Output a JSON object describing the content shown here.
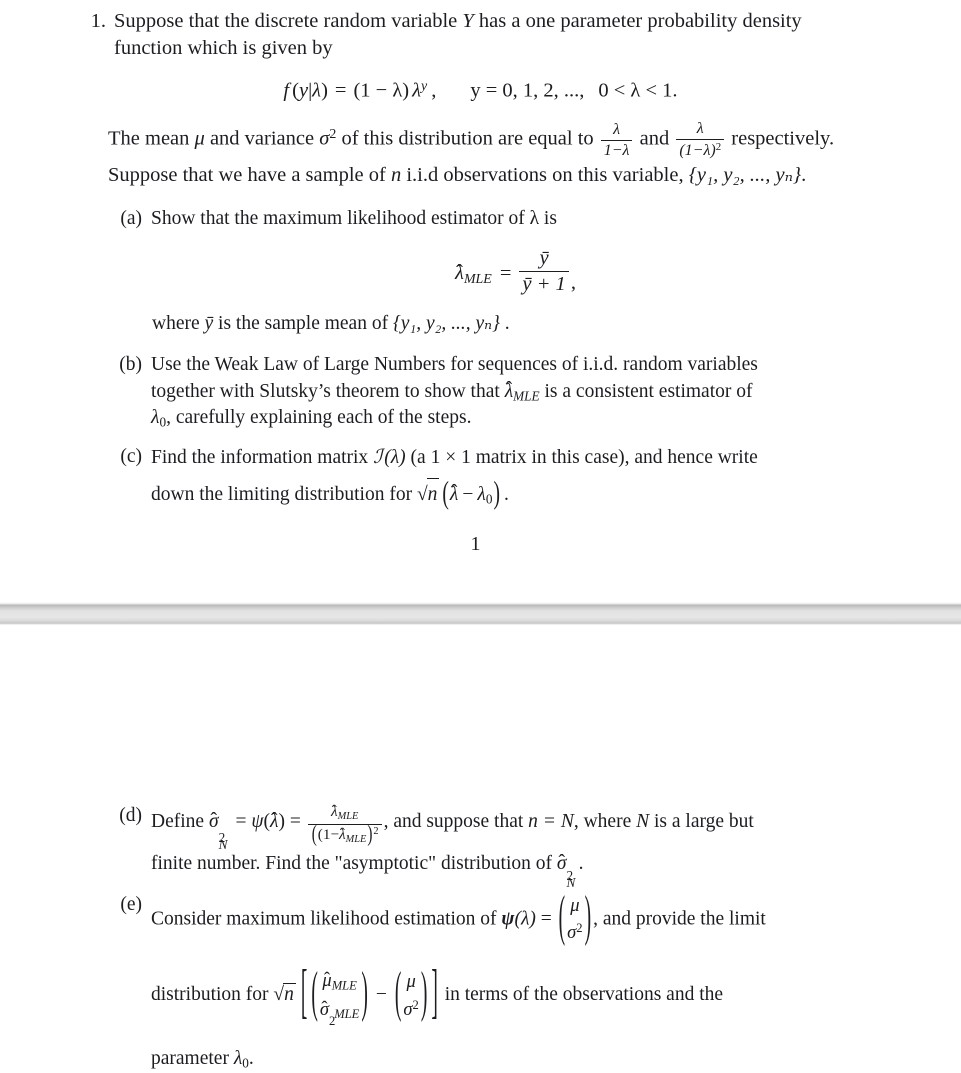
{
  "document": {
    "page_number": "1",
    "question_number": "1.",
    "intro": {
      "line1_a": "Suppose that the discrete random variable ",
      "line1_var": "Y",
      "line1_b": " has a one parameter probability density",
      "line2": "function which is given by"
    },
    "pdf_equation": {
      "f": "f",
      "open": "(",
      "y": "y",
      "bar": "|",
      "lambda": "λ",
      "close": ")",
      "equals": "=",
      "one_minus_lambda": "(1 − λ)",
      "lambda_pow": "λ",
      "exponent_y": "y",
      "comma": ",",
      "support": "y = 0, 1, 2, ...,",
      "range": "0 < λ < 1."
    },
    "moments": {
      "text_a": "The mean ",
      "mu": "μ",
      "text_b": " and variance ",
      "sigma": "σ",
      "sigma_exp": "2",
      "text_c": " of this distribution are equal to ",
      "mean_num": "λ",
      "mean_den": "1−λ",
      "text_and": " and ",
      "var_num": "λ",
      "var_den": "(1−λ)",
      "var_den_exp": "2",
      "text_d": " respectively.",
      "sample_a": "Suppose that we have a sample of ",
      "sample_n": "n",
      "sample_b": "  i.i.d observations on this variable, ",
      "sample_set": "{y₁, y₂, ..., yₙ}",
      "sample_end": "."
    },
    "parts": [
      {
        "marker": "(a)",
        "text": "Show that the maximum likelihood estimator of λ is",
        "equation": {
          "lhs_lambda": "λ",
          "lhs_sub": "MLE",
          "equals": "=",
          "num": "ȳ",
          "den": "ȳ + 1",
          "trailing_comma": ","
        },
        "after": {
          "a": "where ",
          "ybar": "ȳ",
          "b": " is the sample mean of ",
          "set": "{y₁, y₂, ..., yₙ}",
          "c": " ."
        }
      },
      {
        "marker": "(b)",
        "line1": "Use the Weak Law of Large Numbers for sequences of i.i.d.  random variables",
        "line2_a": "together with Slutsky’s theorem to show that ",
        "line2_lambda": "λ",
        "line2_sub": "MLE",
        "line2_b": " is a consistent estimator of",
        "line3_lambda": "λ",
        "line3_sub": "0",
        "line3_b": ", carefully explaining each of the steps."
      },
      {
        "marker": "(c)",
        "line1_a": "Find the information matrix ",
        "line1_script_i": "ℐ",
        "line1_lambda_paren": "(λ)",
        "line1_b": " (a 1 × 1 matrix in this case), and hence write",
        "line2_a": "down the limiting distribution for ",
        "line2_sqrt": "n",
        "line2_lambda_hat": "λ",
        "line2_minus": "−",
        "line2_lambda0": "λ",
        "line2_sub0": "0",
        "line2_end": "."
      },
      {
        "marker": "(d)",
        "line1_a": "Define ",
        "sigma_hat": "σ",
        "sigma_sup": "2",
        "sigma_sub": "N",
        "equals1": " = ",
        "psi": "ψ",
        "psi_arg_lambda": "λ",
        "equals2": " = ",
        "frac_num_lambda": "λ",
        "frac_num_sub": "MLE",
        "frac_den_open": "(1−",
        "frac_den_lambda": "λ",
        "frac_den_sub": "MLE",
        "frac_den_close": ")",
        "frac_den_exp": "2",
        "line1_b": ", and suppose that ",
        "n_eq_N": "n = N",
        "line1_c": ", where ",
        "N": "N",
        "line1_d": " is a large but",
        "line2_a": "finite number. Find the \"asymptotic\" distribution of ",
        "line2_sigma": "σ",
        "line2_sup": "2",
        "line2_sub": "N",
        "line2_end": "."
      },
      {
        "marker": "(e)",
        "line1_a": "Consider maximum likelihood estimation of ",
        "psi": "ψ",
        "psi_arg": "(λ)",
        "equals": " = ",
        "vec_top": "μ",
        "vec_bot_sigma": "σ",
        "vec_bot_sup": "2",
        "line1_b": ", and provide the limit",
        "line2_a": "distribution for ",
        "sqrt_n": "n",
        "mu_hat": "μ",
        "mu_sub": "MLE",
        "sigma_hat": "σ",
        "sigma_sup": "2",
        "sigma_sub": "MLE",
        "minus": "−",
        "mu_plain": "μ",
        "sigma_plain": "σ",
        "sigma_plain_sup": "2",
        "line2_b": " in terms of the observations and the",
        "line3_a": "parameter ",
        "lambda": "λ",
        "lambda_sub": "0",
        "line3_end": "."
      }
    ]
  }
}
